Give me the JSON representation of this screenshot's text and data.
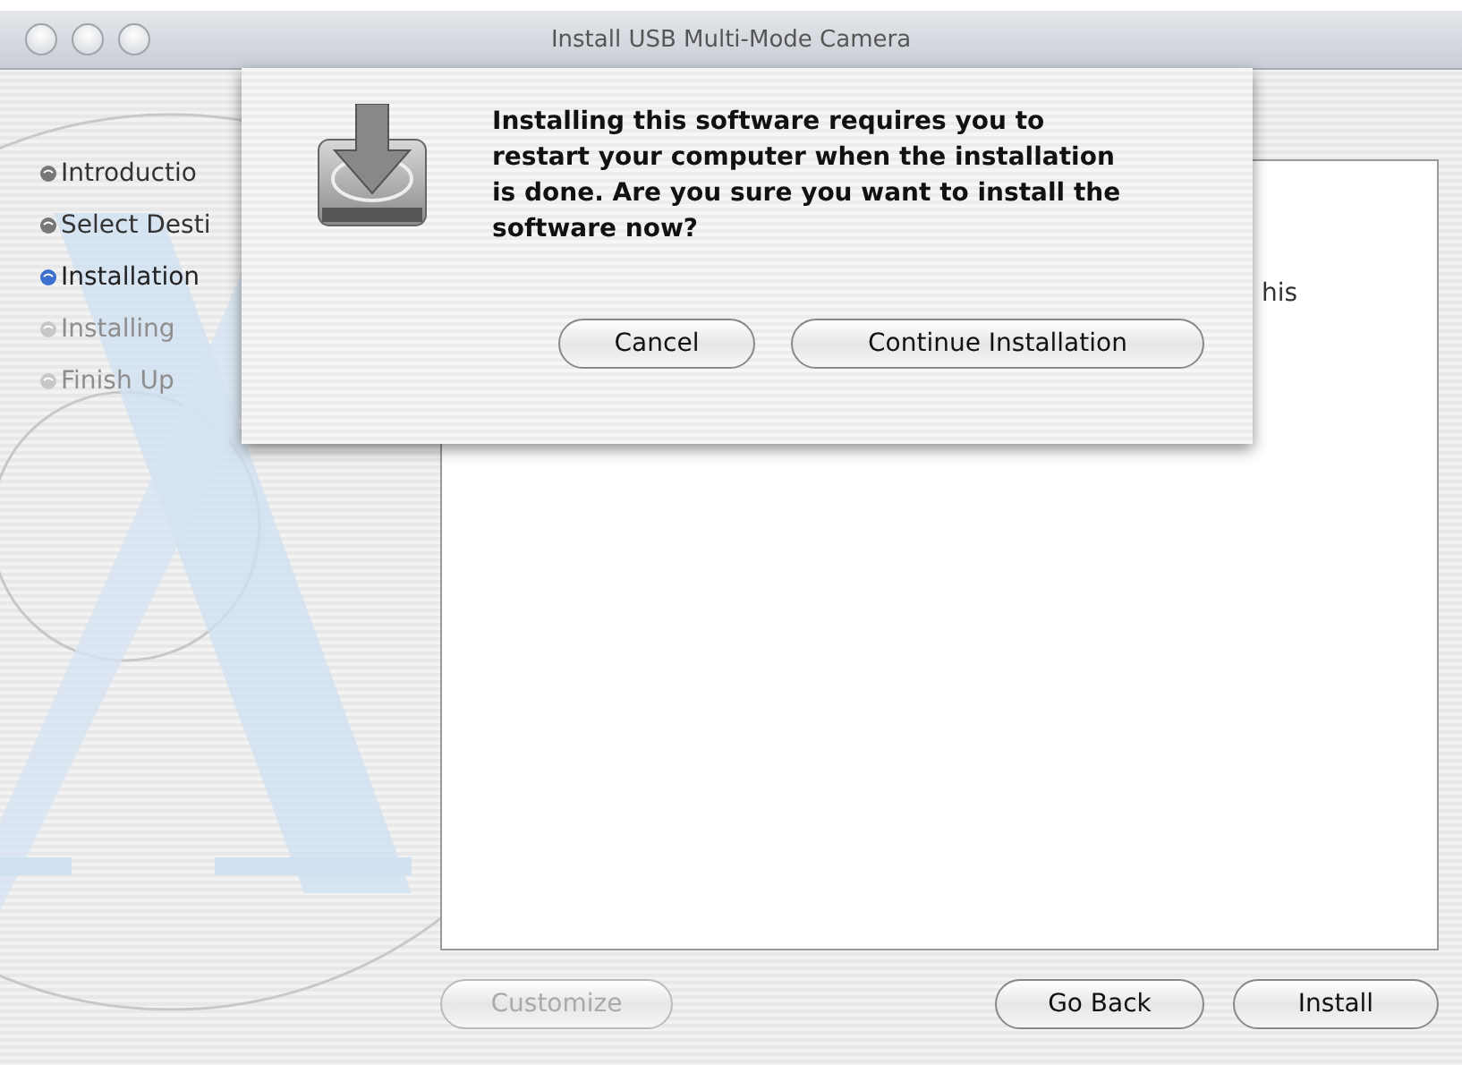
{
  "window": {
    "title": "Install USB Multi-Mode Camera"
  },
  "sidebar": {
    "steps": [
      {
        "label": "Introductio",
        "selected": false,
        "disabled": false
      },
      {
        "label": "Select Desti",
        "selected": false,
        "disabled": false
      },
      {
        "label": "Installation",
        "selected": true,
        "disabled": false
      },
      {
        "label": "Installing",
        "selected": false,
        "disabled": true
      },
      {
        "label": "Finish Up",
        "selected": false,
        "disabled": true
      }
    ]
  },
  "panel": {
    "text": "his"
  },
  "customize_button": {
    "label": "Customize",
    "disabled": true
  },
  "buttons": [
    {
      "label": "Go Back",
      "disabled": false
    },
    {
      "label": "Install",
      "disabled": false
    }
  ],
  "sheet": {
    "message": "Installing this software requires you to restart your computer when the installation is done.  Are you sure you want to install the software now?",
    "buttons": [
      {
        "label": "Cancel"
      },
      {
        "label": "Continue Installation"
      }
    ]
  }
}
